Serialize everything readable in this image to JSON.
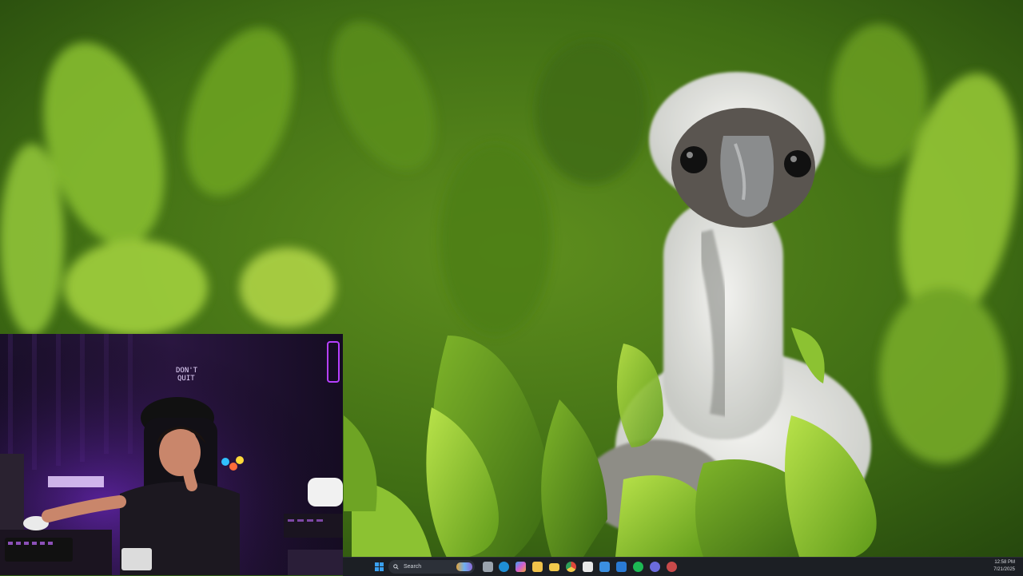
{
  "taskbar": {
    "search_placeholder": "Search",
    "apps": [
      {
        "name": "task-view",
        "color": "#9aa3ad"
      },
      {
        "name": "edge",
        "color": "#1f8fd6"
      },
      {
        "name": "copilot",
        "color": "#d25fd0"
      },
      {
        "name": "photos",
        "color": "#f0c24a"
      },
      {
        "name": "file-explorer",
        "color": "#f2c94c"
      },
      {
        "name": "chrome",
        "color": "#e0b22b"
      },
      {
        "name": "calendar",
        "color": "#e8e8e8"
      },
      {
        "name": "microsoft-store",
        "color": "#3b8fe0"
      },
      {
        "name": "outlook",
        "color": "#2a7ad4"
      },
      {
        "name": "spotify",
        "color": "#1db954"
      },
      {
        "name": "discord",
        "color": "#6b6bdc"
      },
      {
        "name": "browser",
        "color": "#c84a4a"
      }
    ],
    "clock": {
      "time": "12:58 PM",
      "date": "7/21/2025"
    }
  },
  "webcam": {
    "neon_sign_text": "DON'T QUIT",
    "accent_color": "#b640ff"
  },
  "colors": {
    "foliage_dark": "#2f5a12",
    "foliage_light": "#9fd23a",
    "taskbar_bg": "#1c1f24"
  }
}
